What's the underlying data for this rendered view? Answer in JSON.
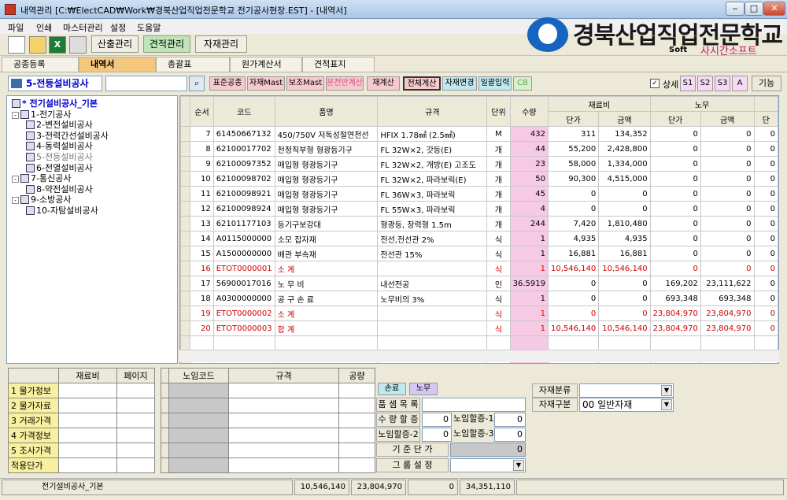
{
  "window": {
    "title": "내역관리 [C:₩ElectCAD₩Work₩경북산업직업전문학교 전기공사현장.EST] - [내역서]"
  },
  "menu": [
    "파일",
    "인쇄",
    "마스터관리",
    "설정",
    "도움말"
  ],
  "toolbar_tabs": [
    "산출관리",
    "견적관리",
    "자재관리"
  ],
  "logo": {
    "text": "경북산업직업전문학교",
    "soft": "Soft",
    "sub": "사시간소프트"
  },
  "subtabs": [
    "공종등록",
    "내역서",
    "총괄표",
    "원가계산서",
    "견적표지"
  ],
  "project_name": "5-전등설비공사",
  "func_buttons": [
    "표준공종",
    "자재Mast",
    "보조Mast",
    "분전반계산",
    "재계산",
    "전체계산",
    "자재변경",
    "일괄입력",
    "CB"
  ],
  "detail_label": "상세",
  "s_buttons": [
    "S1",
    "S2",
    "S3",
    "A"
  ],
  "func_label": "기능",
  "tree": [
    {
      "label": "* 전기설비공사_기본",
      "level": 0,
      "exp": ""
    },
    {
      "label": "1-전기공사",
      "level": 0,
      "exp": "-"
    },
    {
      "label": "2-변전설비공사",
      "level": 1,
      "exp": ""
    },
    {
      "label": "3-전력간선설비공사",
      "level": 1,
      "exp": ""
    },
    {
      "label": "4-동력설비공사",
      "level": 1,
      "exp": ""
    },
    {
      "label": "5-전등설비공사",
      "level": 1,
      "exp": ""
    },
    {
      "label": "6-전열설비공사",
      "level": 1,
      "exp": ""
    },
    {
      "label": "7-통신공사",
      "level": 0,
      "exp": "-"
    },
    {
      "label": "8-약전설비공사",
      "level": 1,
      "exp": ""
    },
    {
      "label": "9-소방공사",
      "level": 0,
      "exp": "-"
    },
    {
      "label": "10-자탐설비공사",
      "level": 1,
      "exp": ""
    }
  ],
  "grid": {
    "headers": {
      "seq": "순서",
      "code": "코드",
      "name": "품명",
      "spec": "규격",
      "unit": "단위",
      "qty": "수량",
      "material": "재료비",
      "labor": "노무",
      "unit_price": "단가",
      "amount": "금액",
      "last": "단"
    },
    "rows": [
      {
        "seq": "7",
        "code": "61450667132",
        "name": "450/750V 저독성절연전선",
        "spec": "HFIX 1.78㎟ (2.5㎟)",
        "unit": "M",
        "qty": "432",
        "mp": "311",
        "ma": "134,352",
        "lp": "0",
        "la": "0",
        "ex": "0",
        "red": false
      },
      {
        "seq": "8",
        "code": "62100017702",
        "name": "천정직부형 형광등기구",
        "spec": "FL 32W×2, 갓등(E)",
        "unit": "개",
        "qty": "44",
        "mp": "55,200",
        "ma": "2,428,800",
        "lp": "0",
        "la": "0",
        "ex": "0",
        "red": false
      },
      {
        "seq": "9",
        "code": "62100097352",
        "name": "매입형 형광등기구",
        "spec": "FL 32W×2, 개방(E) 고조도",
        "unit": "개",
        "qty": "23",
        "mp": "58,000",
        "ma": "1,334,000",
        "lp": "0",
        "la": "0",
        "ex": "0",
        "red": false
      },
      {
        "seq": "10",
        "code": "62100098702",
        "name": "매입형 형광등기구",
        "spec": "FL 32W×2, 파라보릭(E)",
        "unit": "개",
        "qty": "50",
        "mp": "90,300",
        "ma": "4,515,000",
        "lp": "0",
        "la": "0",
        "ex": "0",
        "red": false
      },
      {
        "seq": "11",
        "code": "62100098921",
        "name": "매입형 형광등기구",
        "spec": "FL 36W×3, 파라보릭",
        "unit": "개",
        "qty": "45",
        "mp": "0",
        "ma": "0",
        "lp": "0",
        "la": "0",
        "ex": "0",
        "red": false
      },
      {
        "seq": "12",
        "code": "62100098924",
        "name": "매입형 형광등기구",
        "spec": "FL 55W×3, 파라보릭",
        "unit": "개",
        "qty": "4",
        "mp": "0",
        "ma": "0",
        "lp": "0",
        "la": "0",
        "ex": "0",
        "red": false
      },
      {
        "seq": "13",
        "code": "62101177103",
        "name": "등기구보강대",
        "spec": "형광등, 장력형 1.5m",
        "unit": "개",
        "qty": "244",
        "mp": "7,420",
        "ma": "1,810,480",
        "lp": "0",
        "la": "0",
        "ex": "0",
        "red": false
      },
      {
        "seq": "14",
        "code": "A0115000000",
        "name": "소모 잡자재",
        "spec": "전선,전선관 2%",
        "unit": "식",
        "qty": "1",
        "mp": "4,935",
        "ma": "4,935",
        "lp": "0",
        "la": "0",
        "ex": "0",
        "red": false
      },
      {
        "seq": "15",
        "code": "A1500000000",
        "name": "배관 부속재",
        "spec": "전선관 15%",
        "unit": "식",
        "qty": "1",
        "mp": "16,881",
        "ma": "16,881",
        "lp": "0",
        "la": "0",
        "ex": "0",
        "red": false
      },
      {
        "seq": "16",
        "code": "ETOT0000001",
        "name": "      소      계",
        "spec": "",
        "unit": "식",
        "qty": "1",
        "mp": "10,546,140",
        "ma": "10,546,140",
        "lp": "0",
        "la": "0",
        "ex": "0",
        "red": true
      },
      {
        "seq": "17",
        "code": "56900017016",
        "name": "노 무 비",
        "spec": "내선전공",
        "unit": "인",
        "qty": "36.5919",
        "mp": "0",
        "ma": "0",
        "lp": "169,202",
        "la": "23,111,622",
        "ex": "0",
        "red": false
      },
      {
        "seq": "18",
        "code": "A0300000000",
        "name": "공 구 손 료",
        "spec": "노무비의 3%",
        "unit": "식",
        "qty": "1",
        "mp": "0",
        "ma": "0",
        "lp": "693,348",
        "la": "693,348",
        "ex": "0",
        "red": false
      },
      {
        "seq": "19",
        "code": "ETOT0000002",
        "name": "      소      계",
        "spec": "",
        "unit": "식",
        "qty": "1",
        "mp": "0",
        "ma": "0",
        "lp": "23,804,970",
        "la": "23,804,970",
        "ex": "0",
        "red": true
      },
      {
        "seq": "20",
        "code": "ETOT0000003",
        "name": "      합      계",
        "spec": "",
        "unit": "식",
        "qty": "1",
        "mp": "10,546,140",
        "ma": "10,546,140",
        "lp": "23,804,970",
        "la": "23,804,970",
        "ex": "0",
        "red": true
      }
    ]
  },
  "left_panel": {
    "h1": "재료비",
    "h2": "페이지",
    "rows": [
      "1 물가정보",
      "2 물가자료",
      "3 거래가격",
      "4 가격정보",
      "5 조사가격",
      "적용단가"
    ]
  },
  "mid_panel": {
    "h1": "노임코드",
    "h2": "규격",
    "h3": "공량"
  },
  "prop": {
    "tab1": "손료",
    "tab2": "노무",
    "items_label": "품 셈 목 록",
    "qty_inc": "수 량 할 증",
    "labor_inc1": "노임할증-1",
    "labor_inc2": "노임할증-2",
    "labor_inc3": "노임할증-3",
    "base_price": "기 준 단 가",
    "group": "그 룹 설 정",
    "val_zero": "0"
  },
  "classify": {
    "l1": "자재분류",
    "l2": "자재구분",
    "v2": "00 일반자재"
  },
  "status": {
    "name": "전기설비공사_기본",
    "v1": "10,546,140",
    "v2": "23,804,970",
    "v3": "0",
    "v4": "34,351,110"
  }
}
